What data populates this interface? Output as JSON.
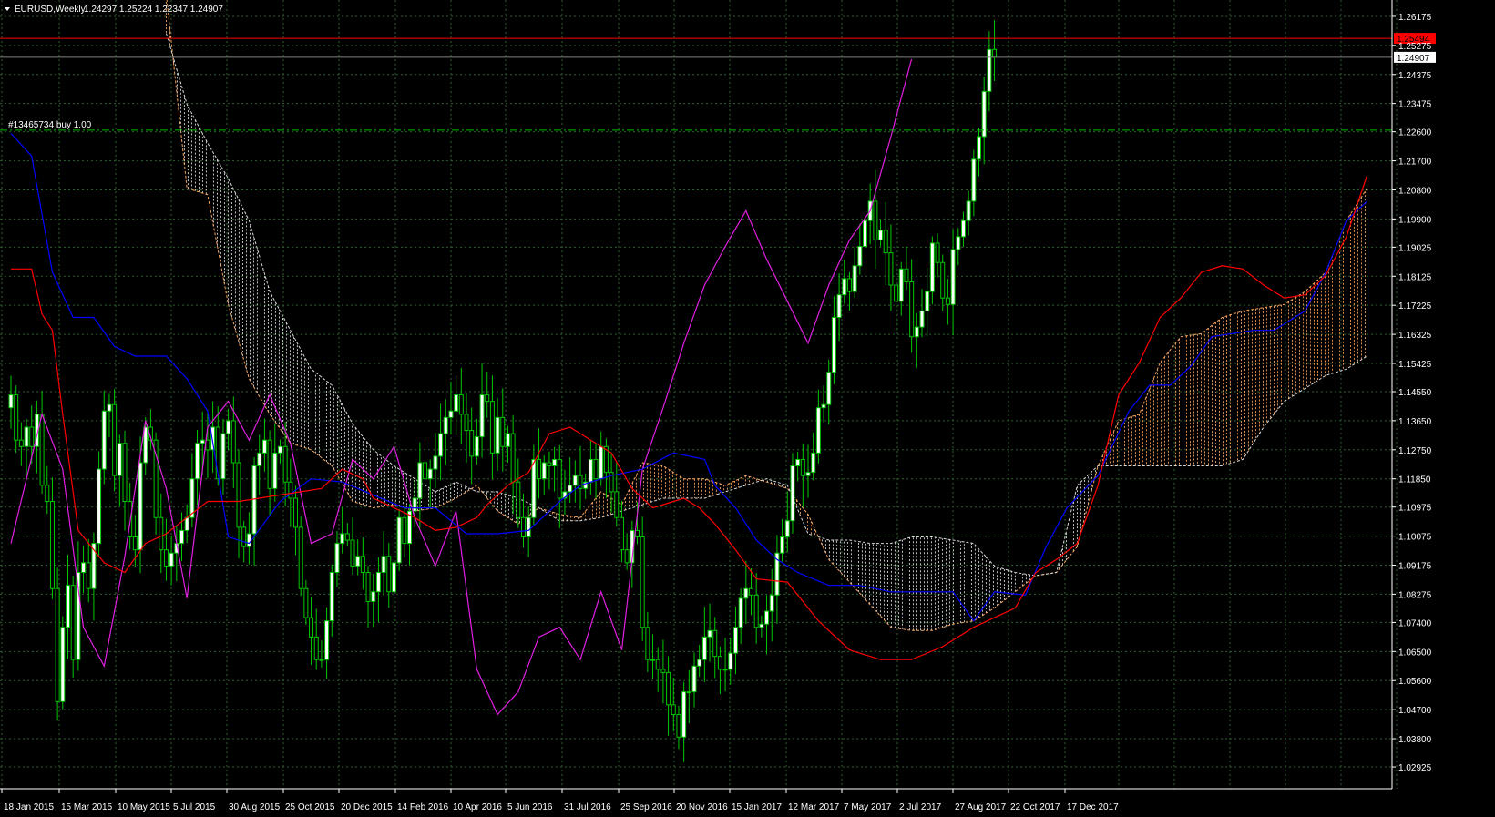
{
  "header": {
    "symbol_timeframe": "EURUSD,Weekly",
    "ohlc": "1.24297 1.25224 1.22347 1.24907"
  },
  "order_line": {
    "label": "#13465734 buy 1.00",
    "price": 1.2265
  },
  "price_tags": {
    "ask_line": "1.25494",
    "ask_value": 1.25494,
    "last": "1.24907",
    "last_value": 1.24907
  },
  "colors": {
    "background": "#000000",
    "grid": "#2e5f2e",
    "bull_candle": "#00c800",
    "bull_body": "#ffffff",
    "bear_candle": "#00c800",
    "bear_body": "#000000",
    "tenkan": "#ff0000",
    "kijun": "#0000ff",
    "chikou": "#e020e0",
    "kumo_bull": "#f4a460",
    "kumo_bear": "#d8d8d8",
    "ask_line": "#ff0000",
    "order_line": "#00c000"
  },
  "chart_data": {
    "type": "candlestick",
    "indicator": "Ichimoku Kinko Hyo",
    "symbol": "EURUSD",
    "timeframe": "Weekly",
    "ylim": [
      1.02925,
      1.26175
    ],
    "y_ticks": [
      "1.26175",
      "1.25275",
      "1.24375",
      "1.23475",
      "1.22600",
      "1.21700",
      "1.20800",
      "1.19900",
      "1.19025",
      "1.18125",
      "1.17225",
      "1.16325",
      "1.15425",
      "1.14550",
      "1.13650",
      "1.12750",
      "1.11850",
      "1.10975",
      "1.10075",
      "1.09175",
      "1.08275",
      "1.07400",
      "1.06500",
      "1.05600",
      "1.04700",
      "1.03800",
      "1.02925"
    ],
    "x_ticks": [
      "18 Jan 2015",
      "15 Mar 2015",
      "10 May 2015",
      "5 Jul 2015",
      "30 Aug 2015",
      "25 Oct 2015",
      "20 Dec 2015",
      "14 Feb 2016",
      "10 Apr 2016",
      "5 Jun 2016",
      "31 Jul 2016",
      "25 Sep 2016",
      "20 Nov 2016",
      "15 Jan 2017",
      "12 Mar 2017",
      "7 May 2017",
      "2 Jul 2017",
      "27 Aug 2017",
      "22 Oct 2017",
      "17 Dec 2017"
    ],
    "close": [
      1.1445,
      1.1305,
      1.1285,
      1.1345,
      1.1285,
      1.1385,
      1.1165,
      1.1115,
      1.0845,
      1.0495,
      1.0725,
      1.0855,
      1.0625,
      1.0895,
      1.0925,
      1.0845,
      1.0985,
      1.1215,
      1.1395,
      1.1415,
      1.1195,
      1.1295,
      1.1115,
      1.1005,
      1.0965,
      1.1235,
      1.1345,
      1.1305,
      1.1065,
      1.0965,
      1.0915,
      1.0955,
      1.0985,
      1.1025,
      1.1065,
      1.1185,
      1.1295,
      1.1305,
      1.1275,
      1.1345,
      1.1185,
      1.1325,
      1.1365,
      1.1235,
      1.1035,
      1.0975,
      1.1015,
      1.1225,
      1.1265,
      1.1305,
      1.1155,
      1.1265,
      1.1285,
      1.1175,
      1.1125,
      1.1035,
      1.0845,
      1.0755,
      1.0695,
      1.0625,
      1.0625,
      1.0745,
      1.0895,
      1.0985,
      1.1015,
      1.0995,
      1.0915,
      1.0945,
      1.0895,
      1.0805,
      1.0835,
      1.0895,
      1.0945,
      1.0835,
      1.0925,
      1.1065,
      1.0985,
      1.1085,
      1.1125,
      1.1235,
      1.1185,
      1.1215,
      1.1255,
      1.1325,
      1.1375,
      1.1395,
      1.1445,
      1.1385,
      1.1335,
      1.1255,
      1.1315,
      1.1445,
      1.1425,
      1.1265,
      1.1375,
      1.1285,
      1.1325,
      1.1175,
      1.1065,
      1.1005,
      1.1065,
      1.1245,
      1.1185,
      1.1235,
      1.1225,
      1.1245,
      1.1125,
      1.1145,
      1.1165,
      1.1195,
      1.1155,
      1.1175,
      1.1245,
      1.1185,
      1.1285,
      1.1205,
      1.1145,
      1.1065,
      1.0965,
      1.0925,
      1.1025,
      1.1005,
      1.0725,
      1.0625,
      1.0625,
      1.0595,
      1.0585,
      1.0485,
      1.0455,
      1.0385,
      1.0525,
      1.0525,
      1.0605,
      1.0625,
      1.0695,
      1.0715,
      1.0635,
      1.0595,
      1.0595,
      1.0645,
      1.0725,
      1.0815,
      1.0845,
      1.0825,
      1.0725,
      1.0735,
      1.0775,
      1.0825,
      1.0955,
      1.1005,
      1.1055,
      1.1225,
      1.1245,
      1.1195,
      1.1205,
      1.1265,
      1.1405,
      1.1415,
      1.1515,
      1.1685,
      1.1755,
      1.1805,
      1.1765,
      1.1845,
      1.1905,
      1.1985,
      1.2045,
      1.1925,
      1.1955,
      1.1885,
      1.1785,
      1.1735,
      1.1835,
      1.1795,
      1.1625,
      1.1655,
      1.1705,
      1.1765,
      1.1915,
      1.1855,
      1.1745,
      1.1725,
      1.1895,
      1.1935,
      1.1985,
      1.2045,
      1.2175,
      1.2245,
      1.2385,
      1.2515,
      1.2491
    ],
    "tenkan": [
      [
        0,
        1.1835
      ],
      [
        4,
        1.1835
      ],
      [
        6,
        1.1695
      ],
      [
        8,
        1.1645
      ],
      [
        10,
        1.1385
      ],
      [
        13,
        1.1025
      ],
      [
        18,
        1.0925
      ],
      [
        22,
        1.0895
      ],
      [
        26,
        1.0985
      ],
      [
        30,
        1.1015
      ],
      [
        34,
        1.1065
      ],
      [
        38,
        1.1115
      ],
      [
        44,
        1.1115
      ],
      [
        48,
        1.1125
      ],
      [
        52,
        1.1135
      ],
      [
        56,
        1.1145
      ],
      [
        60,
        1.1155
      ],
      [
        64,
        1.1215
      ],
      [
        68,
        1.1185
      ],
      [
        70,
        1.1125
      ],
      [
        74,
        1.1095
      ],
      [
        78,
        1.1065
      ],
      [
        82,
        1.1025
      ],
      [
        86,
        1.1035
      ],
      [
        90,
        1.1065
      ],
      [
        92,
        1.1105
      ],
      [
        96,
        1.1165
      ],
      [
        100,
        1.1205
      ],
      [
        104,
        1.1325
      ],
      [
        108,
        1.1345
      ],
      [
        112,
        1.1305
      ],
      [
        116,
        1.1265
      ],
      [
        120,
        1.1155
      ],
      [
        124,
        1.1095
      ],
      [
        128,
        1.1115
      ],
      [
        130,
        1.1125
      ],
      [
        133,
        1.1095
      ],
      [
        136,
        1.1045
      ],
      [
        140,
        1.0965
      ],
      [
        144,
        1.0875
      ],
      [
        150,
        1.0865
      ],
      [
        156,
        1.0745
      ],
      [
        162,
        1.0655
      ],
      [
        168,
        1.0625
      ],
      [
        174,
        1.0625
      ],
      [
        180,
        1.0665
      ],
      [
        186,
        1.0725
      ],
      [
        190,
        1.0755
      ],
      [
        194,
        1.0785
      ],
      [
        198,
        1.0895
      ],
      [
        202,
        1.0935
      ],
      [
        206,
        1.0985
      ],
      [
        210,
        1.1165
      ],
      [
        214,
        1.1445
      ],
      [
        218,
        1.1545
      ],
      [
        222,
        1.1685
      ],
      [
        226,
        1.1745
      ],
      [
        230,
        1.1825
      ],
      [
        234,
        1.1845
      ],
      [
        238,
        1.1835
      ],
      [
        242,
        1.1785
      ],
      [
        246,
        1.1745
      ],
      [
        250,
        1.1755
      ],
      [
        254,
        1.1815
      ],
      [
        258,
        1.1935
      ],
      [
        262,
        1.2125
      ]
    ],
    "kijun": [
      [
        0,
        1.2255
      ],
      [
        4,
        1.2185
      ],
      [
        8,
        1.1825
      ],
      [
        12,
        1.1685
      ],
      [
        16,
        1.1685
      ],
      [
        20,
        1.1595
      ],
      [
        24,
        1.1565
      ],
      [
        30,
        1.1565
      ],
      [
        34,
        1.1495
      ],
      [
        38,
        1.1395
      ],
      [
        42,
        1.1005
      ],
      [
        46,
        1.0985
      ],
      [
        52,
        1.1115
      ],
      [
        58,
        1.1185
      ],
      [
        64,
        1.1175
      ],
      [
        70,
        1.1135
      ],
      [
        76,
        1.1095
      ],
      [
        82,
        1.1095
      ],
      [
        88,
        1.1015
      ],
      [
        94,
        1.1015
      ],
      [
        100,
        1.1025
      ],
      [
        106,
        1.1115
      ],
      [
        110,
        1.1165
      ],
      [
        116,
        1.1195
      ],
      [
        122,
        1.1215
      ],
      [
        128,
        1.1265
      ],
      [
        134,
        1.1245
      ],
      [
        136,
        1.1165
      ],
      [
        140,
        1.1095
      ],
      [
        144,
        1.0995
      ],
      [
        148,
        1.0935
      ],
      [
        152,
        1.0895
      ],
      [
        158,
        1.0855
      ],
      [
        164,
        1.0855
      ],
      [
        170,
        1.0835
      ],
      [
        176,
        1.0835
      ],
      [
        182,
        1.0835
      ],
      [
        186,
        1.0745
      ],
      [
        190,
        1.0835
      ],
      [
        196,
        1.0825
      ],
      [
        200,
        1.0975
      ],
      [
        204,
        1.1095
      ],
      [
        210,
        1.1195
      ],
      [
        216,
        1.1395
      ],
      [
        220,
        1.1475
      ],
      [
        224,
        1.1475
      ],
      [
        228,
        1.1535
      ],
      [
        232,
        1.1625
      ],
      [
        236,
        1.1635
      ],
      [
        240,
        1.1645
      ],
      [
        244,
        1.1645
      ],
      [
        250,
        1.1705
      ],
      [
        254,
        1.1825
      ],
      [
        258,
        1.1985
      ],
      [
        262,
        1.2045
      ]
    ],
    "chikou": [
      [
        0,
        1.0985
      ],
      [
        6,
        1.1385
      ],
      [
        10,
        1.1215
      ],
      [
        14,
        1.0725
      ],
      [
        18,
        1.0605
      ],
      [
        22,
        1.0945
      ],
      [
        26,
        1.1365
      ],
      [
        30,
        1.1155
      ],
      [
        34,
        1.0815
      ],
      [
        38,
        1.1345
      ],
      [
        42,
        1.1425
      ],
      [
        46,
        1.1305
      ],
      [
        50,
        1.1445
      ],
      [
        54,
        1.1295
      ],
      [
        58,
        1.0985
      ],
      [
        62,
        1.1015
      ],
      [
        66,
        1.1245
      ],
      [
        70,
        1.1185
      ],
      [
        74,
        1.1285
      ],
      [
        78,
        1.1065
      ],
      [
        82,
        1.0915
      ],
      [
        86,
        1.1085
      ],
      [
        90,
        1.0595
      ],
      [
        94,
        1.0455
      ],
      [
        98,
        1.0525
      ],
      [
        102,
        1.0695
      ],
      [
        106,
        1.0725
      ],
      [
        110,
        1.0625
      ],
      [
        114,
        1.0835
      ],
      [
        118,
        1.0655
      ],
      [
        122,
        1.1215
      ],
      [
        126,
        1.1405
      ],
      [
        130,
        1.1605
      ],
      [
        134,
        1.1785
      ],
      [
        138,
        1.1905
      ],
      [
        142,
        1.2015
      ],
      [
        146,
        1.1865
      ],
      [
        150,
        1.1735
      ],
      [
        154,
        1.1605
      ],
      [
        158,
        1.1785
      ],
      [
        162,
        1.1925
      ],
      [
        166,
        1.2015
      ],
      [
        170,
        1.2245
      ],
      [
        174,
        1.2485
      ]
    ],
    "senkou_a": [
      [
        30,
        1.2685
      ],
      [
        34,
        1.2085
      ],
      [
        38,
        1.2065
      ],
      [
        42,
        1.1725
      ],
      [
        46,
        1.1495
      ],
      [
        50,
        1.1385
      ],
      [
        54,
        1.1295
      ],
      [
        58,
        1.1275
      ],
      [
        62,
        1.1225
      ],
      [
        66,
        1.1115
      ],
      [
        70,
        1.1095
      ],
      [
        74,
        1.1105
      ],
      [
        78,
        1.1085
      ],
      [
        82,
        1.1095
      ],
      [
        86,
        1.1125
      ],
      [
        90,
        1.1165
      ],
      [
        94,
        1.1085
      ],
      [
        98,
        1.1045
      ],
      [
        102,
        1.1095
      ],
      [
        106,
        1.1075
      ],
      [
        110,
        1.1065
      ],
      [
        114,
        1.1145
      ],
      [
        118,
        1.1105
      ],
      [
        122,
        1.1235
      ],
      [
        126,
        1.1225
      ],
      [
        130,
        1.1185
      ],
      [
        134,
        1.1185
      ],
      [
        138,
        1.1165
      ],
      [
        142,
        1.1195
      ],
      [
        146,
        1.1175
      ],
      [
        150,
        1.1155
      ],
      [
        154,
        1.1075
      ],
      [
        158,
        1.0935
      ],
      [
        162,
        1.0865
      ],
      [
        166,
        1.0795
      ],
      [
        170,
        1.0725
      ],
      [
        174,
        1.0715
      ],
      [
        178,
        1.0715
      ],
      [
        182,
        1.0735
      ],
      [
        186,
        1.0745
      ],
      [
        190,
        1.0785
      ],
      [
        194,
        1.0835
      ],
      [
        198,
        1.0885
      ],
      [
        202,
        1.0895
      ],
      [
        206,
        1.0975
      ],
      [
        210,
        1.1225
      ],
      [
        214,
        1.1365
      ],
      [
        218,
        1.1385
      ],
      [
        222,
        1.1545
      ],
      [
        226,
        1.1625
      ],
      [
        230,
        1.1635
      ],
      [
        234,
        1.1685
      ],
      [
        238,
        1.1705
      ],
      [
        242,
        1.1715
      ],
      [
        246,
        1.1725
      ],
      [
        250,
        1.1765
      ],
      [
        254,
        1.1825
      ],
      [
        258,
        1.1985
      ],
      [
        262,
        1.2085
      ]
    ],
    "senkou_b": [
      [
        30,
        1.2565
      ],
      [
        34,
        1.2345
      ],
      [
        38,
        1.2225
      ],
      [
        42,
        1.2115
      ],
      [
        46,
        1.1985
      ],
      [
        50,
        1.1765
      ],
      [
        54,
        1.1645
      ],
      [
        58,
        1.1525
      ],
      [
        62,
        1.1475
      ],
      [
        66,
        1.1355
      ],
      [
        70,
        1.1275
      ],
      [
        74,
        1.1225
      ],
      [
        78,
        1.1185
      ],
      [
        82,
        1.1145
      ],
      [
        86,
        1.1175
      ],
      [
        90,
        1.1145
      ],
      [
        94,
        1.1145
      ],
      [
        98,
        1.1125
      ],
      [
        102,
        1.1095
      ],
      [
        106,
        1.1055
      ],
      [
        110,
        1.1055
      ],
      [
        114,
        1.1065
      ],
      [
        118,
        1.1085
      ],
      [
        122,
        1.1105
      ],
      [
        126,
        1.1125
      ],
      [
        130,
        1.1125
      ],
      [
        134,
        1.1125
      ],
      [
        138,
        1.1145
      ],
      [
        142,
        1.1165
      ],
      [
        146,
        1.1185
      ],
      [
        150,
        1.1165
      ],
      [
        154,
        1.1015
      ],
      [
        158,
        1.0995
      ],
      [
        162,
        1.0995
      ],
      [
        166,
        1.0985
      ],
      [
        170,
        1.0985
      ],
      [
        174,
        1.1005
      ],
      [
        178,
        1.1005
      ],
      [
        182,
        1.0995
      ],
      [
        186,
        1.0985
      ],
      [
        190,
        1.0915
      ],
      [
        194,
        1.0895
      ],
      [
        198,
        1.0885
      ],
      [
        202,
        1.0895
      ],
      [
        206,
        1.1165
      ],
      [
        210,
        1.1225
      ],
      [
        214,
        1.1225
      ],
      [
        218,
        1.1225
      ],
      [
        222,
        1.1225
      ],
      [
        226,
        1.1225
      ],
      [
        230,
        1.1225
      ],
      [
        234,
        1.1225
      ],
      [
        238,
        1.1245
      ],
      [
        242,
        1.1345
      ],
      [
        246,
        1.1425
      ],
      [
        250,
        1.1465
      ],
      [
        254,
        1.1505
      ],
      [
        258,
        1.1525
      ],
      [
        262,
        1.1565
      ]
    ]
  }
}
